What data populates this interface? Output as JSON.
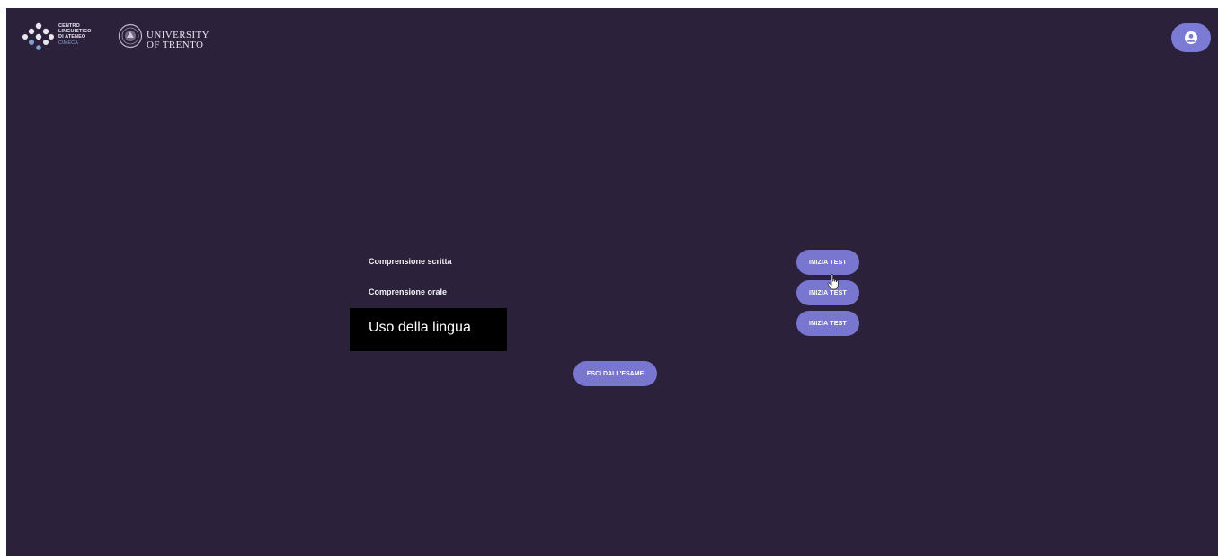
{
  "header": {
    "cla_logo": {
      "lines": [
        "CENTRO",
        "LINGUISTICO",
        "DI ATENEO"
      ],
      "sub": "CIMÈCA",
      "icon": "cla-dots-logo"
    },
    "unitn_logo": {
      "line1": "UNIVERSITY",
      "line2": "OF TRENTO",
      "icon": "university-seal"
    },
    "user_icon": "user-circle-icon"
  },
  "exams": [
    {
      "label": "Comprensione scritta",
      "button": "INIZIA TEST"
    },
    {
      "label": "Comprensione orale",
      "button": "INIZIA TEST"
    },
    {
      "label": "Uso della lingua",
      "button": "INIZIA TEST"
    }
  ],
  "tooltip": {
    "text": "Uso della lingua"
  },
  "exit_button": "ESCI DALL'ESAME",
  "colors": {
    "background": "#2b213b",
    "accent": "#7876cf",
    "text": "#f2f0f6"
  }
}
